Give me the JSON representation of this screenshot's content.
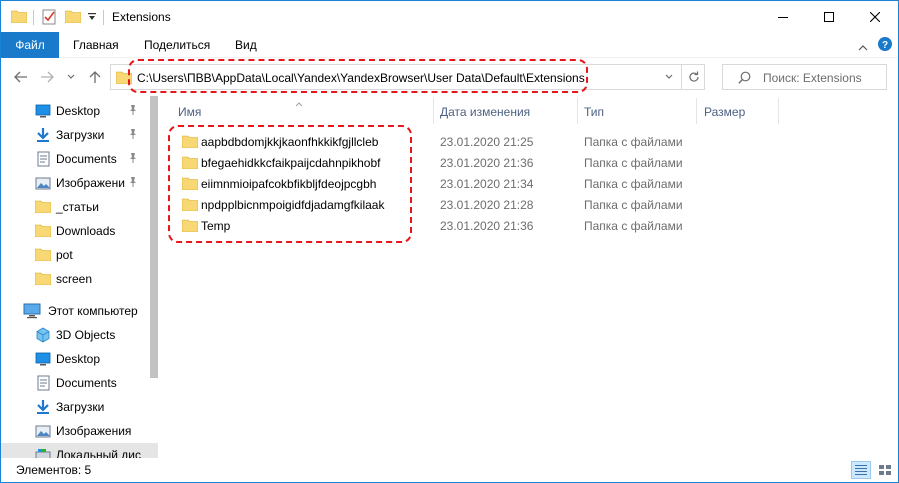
{
  "window": {
    "title": "Extensions",
    "minimize_label": "—",
    "maximize_label": "☐",
    "close_label": "✕"
  },
  "ribbon": {
    "tabs": [
      {
        "label": "Файл"
      },
      {
        "label": "Главная"
      },
      {
        "label": "Поделиться"
      },
      {
        "label": "Вид"
      }
    ]
  },
  "address": {
    "path": "C:\\Users\\ПВВ\\AppData\\Local\\Yandex\\YandexBrowser\\User Data\\Default\\Extensions"
  },
  "search": {
    "placeholder": "Поиск: Extensions"
  },
  "columns": {
    "name": "Имя",
    "date": "Дата изменения",
    "type": "Тип",
    "size": "Размер"
  },
  "sidebar": {
    "quick_access": [
      {
        "label": "Desktop",
        "icon": "desktop-icon",
        "pinned": true
      },
      {
        "label": "Загрузки",
        "icon": "download-icon",
        "pinned": true
      },
      {
        "label": "Documents",
        "icon": "documents-icon",
        "pinned": true
      },
      {
        "label": "Изображени",
        "icon": "pictures-icon",
        "pinned": true
      },
      {
        "label": "_статьи",
        "icon": "folder-icon",
        "pinned": false
      },
      {
        "label": "Downloads",
        "icon": "folder-icon",
        "pinned": false
      },
      {
        "label": "pot",
        "icon": "folder-icon",
        "pinned": false
      },
      {
        "label": "screen",
        "icon": "folder-icon",
        "pinned": false
      }
    ],
    "this_pc": {
      "label": "Этот компьютер",
      "icon": "computer-icon"
    },
    "pc_items": [
      {
        "label": "3D Objects",
        "icon": "3d-objects-icon"
      },
      {
        "label": "Desktop",
        "icon": "desktop-icon"
      },
      {
        "label": "Documents",
        "icon": "documents-icon"
      },
      {
        "label": "Загрузки",
        "icon": "download-icon"
      },
      {
        "label": "Изображения",
        "icon": "pictures-icon"
      },
      {
        "label": "Локальный дис",
        "icon": "drive-icon"
      }
    ]
  },
  "files": [
    {
      "name": "aapbdbdomjkkjkaonfhkkikfgjllcleb",
      "date": "23.01.2020 21:25",
      "type": "Папка с файлами"
    },
    {
      "name": "bfegaehidkkcfaikpaijcdahnpikhobf",
      "date": "23.01.2020 21:36",
      "type": "Папка с файлами"
    },
    {
      "name": "eiimnmioipafcokbfikbljfdeojpcgbh",
      "date": "23.01.2020 21:34",
      "type": "Папка с файлами"
    },
    {
      "name": "npdpplbicnmpoigidfdjadamgfkilaak",
      "date": "23.01.2020 21:28",
      "type": "Папка с файлами"
    },
    {
      "name": "Temp",
      "date": "23.01.2020 21:36",
      "type": "Папка с файлами"
    }
  ],
  "status": {
    "text": "Элементов: 5"
  },
  "colors": {
    "accent": "#1979ca",
    "annotation": "#e8151b",
    "folder": "#f8d775"
  }
}
